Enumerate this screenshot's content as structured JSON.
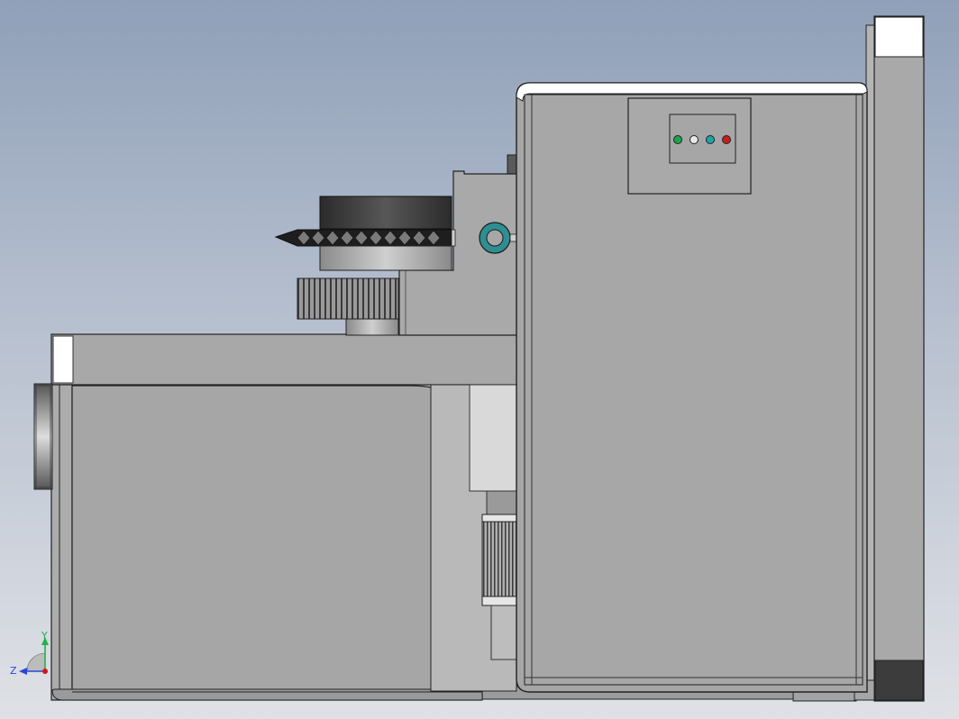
{
  "viewport": {
    "title": "",
    "background_top": "#8fa0b8",
    "background_bottom": "#dfe1e6"
  },
  "indicator_panel": {
    "leds": [
      {
        "name": "green-led",
        "color": "#1aa64a"
      },
      {
        "name": "white-led",
        "color": "#e8e8e8"
      },
      {
        "name": "cyan-led",
        "color": "#1fa3a8"
      },
      {
        "name": "red-led",
        "color": "#c81e1e"
      }
    ]
  },
  "triad": {
    "y_label": "Y",
    "z_label": "Z",
    "y_color": "#22b14c",
    "z_color": "#2848d8",
    "x_color": "#d01818"
  },
  "model": {
    "body_color": "#a6a6a6",
    "edge_color": "#2a2a2a",
    "dark_part_color": "#3c3c3c",
    "knob_color": "#2f8e92"
  }
}
